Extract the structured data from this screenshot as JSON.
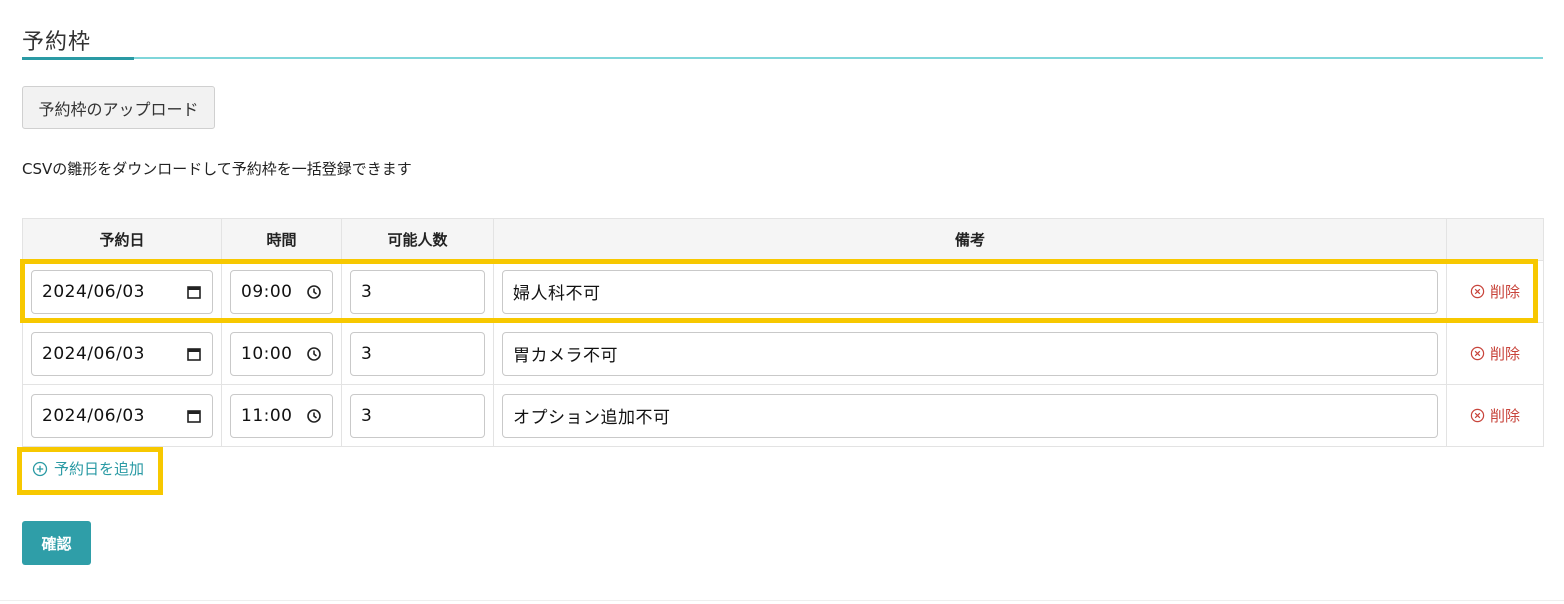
{
  "section": {
    "title": "予約枠",
    "upload_button": "予約枠のアップロード",
    "description": "CSVの雛形をダウンロードして予約枠を一括登録できます"
  },
  "table": {
    "headers": [
      "予約日",
      "時間",
      "可能人数",
      "備考",
      ""
    ],
    "rows": [
      {
        "date": "2024/06/03",
        "time": "09:00",
        "capacity": "3",
        "note": "婦人科不可",
        "delete_label": "削除"
      },
      {
        "date": "2024/06/03",
        "time": "10:00",
        "capacity": "3",
        "note": "胃カメラ不可",
        "delete_label": "削除"
      },
      {
        "date": "2024/06/03",
        "time": "11:00",
        "capacity": "3",
        "note": "オプション追加不可",
        "delete_label": "削除"
      }
    ]
  },
  "add_date_label": "予約日を追加",
  "confirm_button": "確認",
  "colors": {
    "accent": "#2a9aa4",
    "highlight": "#f7c800",
    "delete": "#c8443b"
  },
  "icons": {
    "date": "calendar-icon",
    "time": "clock-icon",
    "delete": "circle-x-icon",
    "add": "circle-plus-icon"
  }
}
